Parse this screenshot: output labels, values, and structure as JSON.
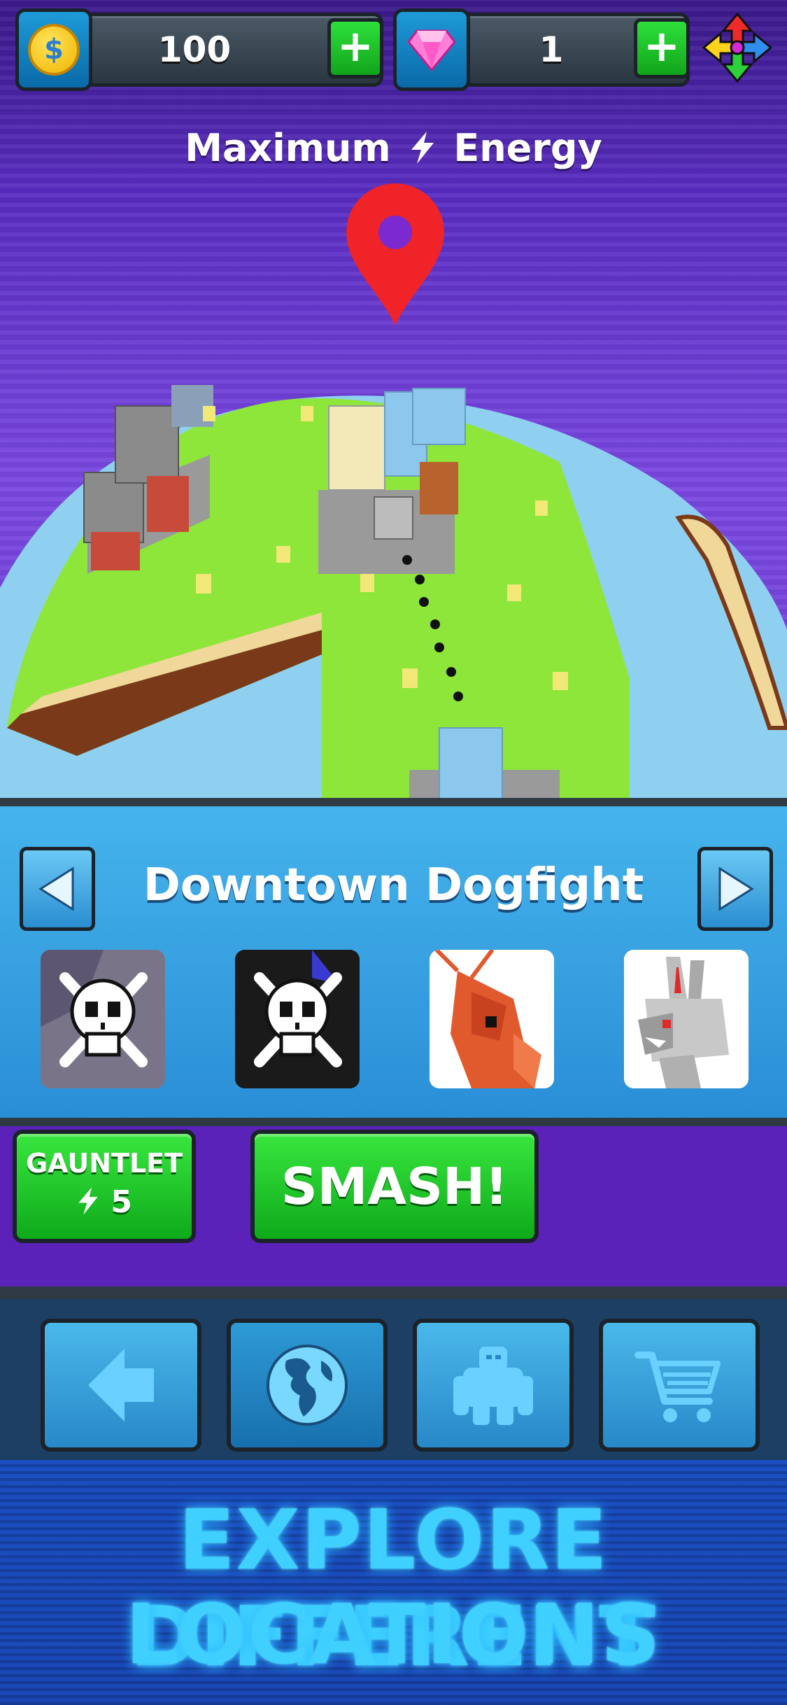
{
  "currency": {
    "coins": {
      "value": "100",
      "icon": "coin-icon"
    },
    "gems": {
      "value": "1",
      "icon": "gem-icon"
    }
  },
  "header": {
    "title_before": "Maximum",
    "title_after": "Energy"
  },
  "location": {
    "name": "Downtown Dogfight",
    "monsters": [
      {
        "icon": "skull-crossbones-icon",
        "kind": "locked"
      },
      {
        "icon": "skull-crossbones-icon",
        "kind": "locked"
      },
      {
        "icon": "red-shrimp-monster-icon",
        "kind": "unlocked"
      },
      {
        "icon": "grey-rabbit-monster-icon",
        "kind": "unlocked"
      }
    ]
  },
  "actions": {
    "gauntlet_label": "GAUNTLET",
    "gauntlet_cost": "5",
    "smash_label": "SMASH!"
  },
  "nav": {
    "items": [
      {
        "icon": "back-arrow-icon"
      },
      {
        "icon": "globe-icon",
        "active": true
      },
      {
        "icon": "gorilla-icon"
      },
      {
        "icon": "shopping-cart-icon"
      }
    ]
  },
  "banner": {
    "line1": "EXPLORE DIFFERENT",
    "line2": "LOCATIONS"
  },
  "colors": {
    "green_button": "#1cc32a",
    "panel_blue": "#3aa6e6",
    "banner_text": "#3fd0ff",
    "pin_red": "#ef2328"
  }
}
